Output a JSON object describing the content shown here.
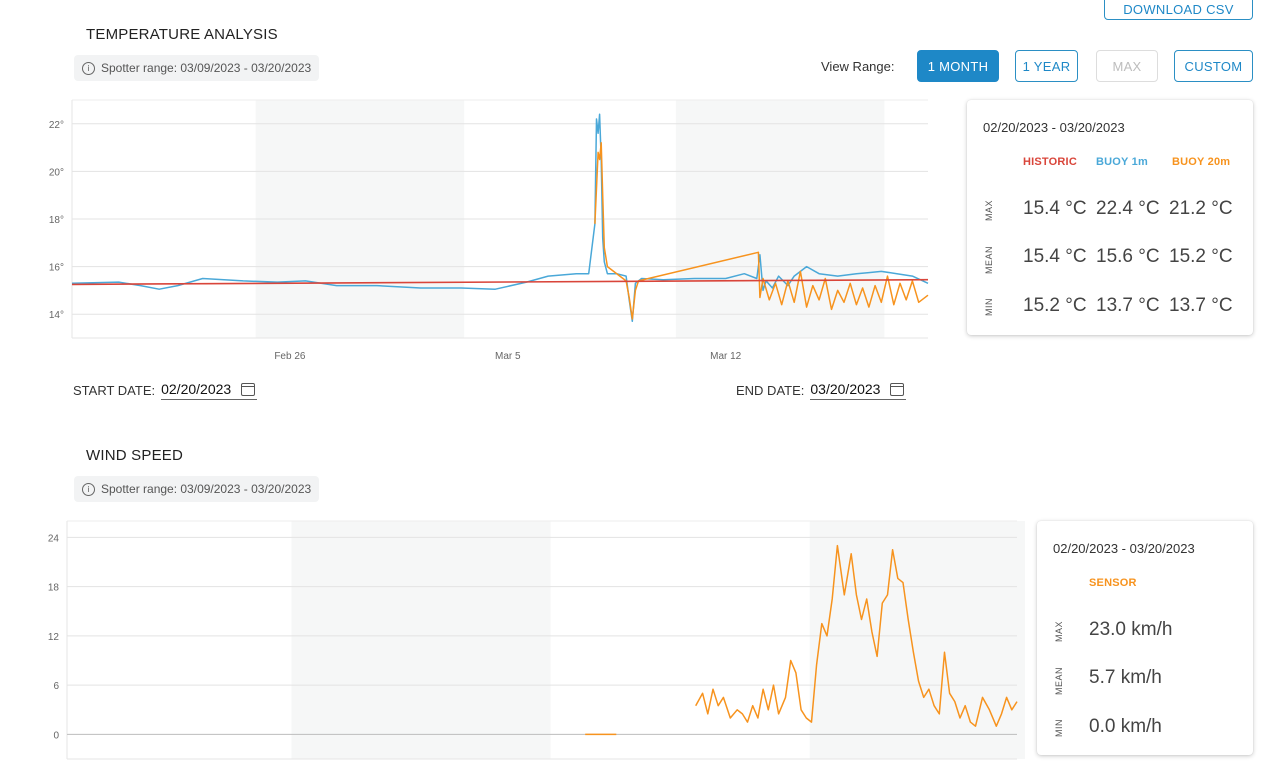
{
  "header": {
    "download_label": "DOWNLOAD CSV"
  },
  "temperature": {
    "title": "TEMPERATURE ANALYSIS",
    "spotter_range": "Spotter range: 03/09/2023 - 03/20/2023",
    "view_range_label": "View Range:",
    "range_buttons": [
      "1 MONTH",
      "1 YEAR",
      "MAX",
      "CUSTOM"
    ],
    "start_date_label": "START DATE:",
    "start_date": "02/20/2023",
    "end_date_label": "END DATE:",
    "end_date": "03/20/2023",
    "stats": {
      "range": "02/20/2023 - 03/20/2023",
      "columns": [
        "HISTORIC",
        "BUOY 1m",
        "BUOY 20m"
      ],
      "colors": [
        "#d9453a",
        "#4aa8d8",
        "#f7931e"
      ],
      "rows": [
        {
          "label": "MAX",
          "values": [
            "15.4 °C",
            "22.4 °C",
            "21.2 °C"
          ]
        },
        {
          "label": "MEAN",
          "values": [
            "15.4 °C",
            "15.6 °C",
            "15.2 °C"
          ]
        },
        {
          "label": "MIN",
          "values": [
            "15.2 °C",
            "13.7 °C",
            "13.7 °C"
          ]
        }
      ]
    }
  },
  "wind": {
    "title": "WIND SPEED",
    "spotter_range": "Spotter range: 03/09/2023 - 03/20/2023",
    "stats": {
      "range": "02/20/2023 - 03/20/2023",
      "column": "SENSOR",
      "color": "#f7931e",
      "rows": [
        {
          "label": "MAX",
          "value": "23.0 km/h"
        },
        {
          "label": "MEAN",
          "value": "5.7 km/h"
        },
        {
          "label": "MIN",
          "value": "0.0 km/h"
        }
      ]
    }
  },
  "chart_data": [
    {
      "type": "line",
      "x_tick_labels": [
        "Feb 26",
        "Mar 5",
        "Mar 12"
      ],
      "y_tick_labels": [
        "14°",
        "16°",
        "18°",
        "20°",
        "22°"
      ],
      "ylim": [
        13,
        23
      ],
      "grid": true,
      "series": [
        {
          "name": "HISTORIC",
          "color": "#d9453a",
          "x": [
            0,
            27.5
          ],
          "y": [
            15.25,
            15.45
          ]
        },
        {
          "name": "BUOY 1m",
          "color": "#4aa8d8",
          "x": [
            0,
            1.5,
            2.2,
            2.8,
            3.4,
            4.2,
            5.5,
            6.6,
            7.5,
            8.5,
            9.8,
            11.2,
            12.5,
            13.6,
            14.6,
            15.3,
            16.2,
            16.6,
            16.8,
            16.85,
            16.9,
            16.95,
            17.0,
            17.05,
            17.1,
            17.2,
            17.5,
            17.8,
            17.9,
            18.0,
            18.1,
            18.3,
            19.0,
            20.0,
            21.0,
            21.6,
            22.0,
            22.1,
            22.2,
            22.3,
            22.5,
            22.7,
            23.0,
            23.2,
            23.6,
            24.0,
            24.6,
            25.2,
            25.6,
            26.0,
            26.5,
            27.0,
            27.5
          ],
          "y": [
            15.3,
            15.35,
            15.2,
            15.05,
            15.2,
            15.5,
            15.4,
            15.35,
            15.4,
            15.2,
            15.2,
            15.1,
            15.1,
            15.05,
            15.35,
            15.6,
            15.7,
            15.7,
            17.8,
            22.2,
            21.6,
            22.4,
            20.5,
            17.2,
            16.2,
            15.7,
            15.7,
            15.6,
            14.6,
            13.7,
            15.3,
            15.5,
            15.45,
            15.5,
            15.5,
            15.7,
            15.5,
            16.5,
            15.0,
            15.4,
            15.1,
            15.6,
            15.2,
            15.6,
            16.0,
            15.7,
            15.6,
            15.7,
            15.75,
            15.8,
            15.7,
            15.6,
            15.3
          ]
        },
        {
          "name": "BUOY 20m",
          "color": "#f7931e",
          "x": [
            16.8,
            16.9,
            16.95,
            17.0,
            17.05,
            17.1,
            17.2,
            17.8,
            17.9,
            18.0,
            18.1,
            18.2,
            22.05,
            22.1,
            22.2,
            22.4,
            22.6,
            22.8,
            23.0,
            23.2,
            23.4,
            23.6,
            23.8,
            24.0,
            24.2,
            24.4,
            24.6,
            24.8,
            25.0,
            25.2,
            25.4,
            25.6,
            25.8,
            26.0,
            26.2,
            26.4,
            26.6,
            26.8,
            27.0,
            27.2,
            27.5
          ],
          "y": [
            17.8,
            20.8,
            20.5,
            21.2,
            19.0,
            16.8,
            16.0,
            15.4,
            14.7,
            13.8,
            15.0,
            15.4,
            16.6,
            14.7,
            15.5,
            14.6,
            15.3,
            14.4,
            15.4,
            14.5,
            15.8,
            14.3,
            15.2,
            14.6,
            15.5,
            14.2,
            15.0,
            14.5,
            15.3,
            14.4,
            15.1,
            14.3,
            15.2,
            14.5,
            15.6,
            14.4,
            15.3,
            14.6,
            15.4,
            14.5,
            14.8
          ]
        }
      ]
    },
    {
      "type": "line",
      "y_tick_labels": [
        "0",
        "6",
        "12",
        "18",
        "24"
      ],
      "ylim": [
        -3,
        26
      ],
      "grid": true,
      "series": [
        {
          "name": "SENSOR",
          "color": "#f7931e",
          "x": [
            18.2,
            18.4,
            18.55,
            18.7,
            18.85,
            19.0,
            19.2,
            19.4,
            19.55,
            19.7,
            19.85,
            20.0,
            20.15,
            20.3,
            20.45,
            20.6,
            20.8,
            20.95,
            21.1,
            21.25,
            21.4,
            21.55,
            21.7,
            21.85,
            22.0,
            22.15,
            22.3,
            22.5,
            22.7,
            22.85,
            23.0,
            23.15,
            23.3,
            23.45,
            23.6,
            23.75,
            23.9,
            24.05,
            24.2,
            24.35,
            24.5,
            24.65,
            24.8,
            24.95,
            25.1,
            25.25,
            25.4,
            25.55,
            25.7,
            25.85,
            26.0,
            26.15,
            26.3,
            26.5,
            26.7,
            26.9,
            27.05,
            27.2,
            27.35,
            27.5
          ],
          "y": [
            3.5,
            5.0,
            2.5,
            5.5,
            3.5,
            4.5,
            2.0,
            3.0,
            2.5,
            1.5,
            3.5,
            2.0,
            5.5,
            3.0,
            6.0,
            2.5,
            4.5,
            9.0,
            7.5,
            3.0,
            2.0,
            1.5,
            8.5,
            13.5,
            12.0,
            16.5,
            23.0,
            17.0,
            22.0,
            17.0,
            14.0,
            16.5,
            12.5,
            9.5,
            16.0,
            17.0,
            22.5,
            19.0,
            18.5,
            14.0,
            10.0,
            6.5,
            4.5,
            5.5,
            3.5,
            2.5,
            10.0,
            5.0,
            4.0,
            2.0,
            3.5,
            1.5,
            1.0,
            4.5,
            3.0,
            1.0,
            2.5,
            4.5,
            3.0,
            4.0
          ]
        },
        {
          "name": "SENSOR",
          "color": "#f7931e",
          "x": [
            15.0,
            15.9
          ],
          "y": [
            0,
            0
          ]
        }
      ]
    }
  ]
}
